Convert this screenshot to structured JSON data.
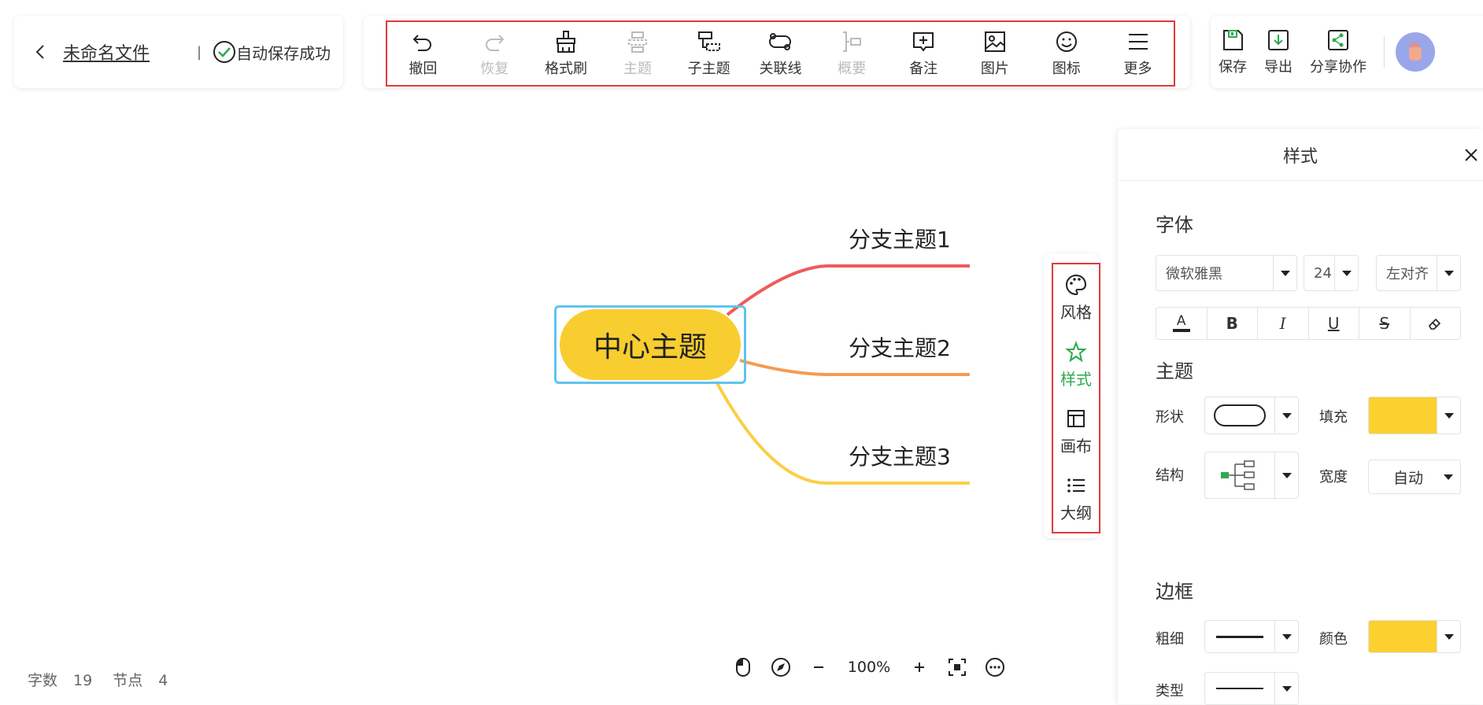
{
  "header": {
    "file_name": "未命名文件",
    "separator": "|",
    "save_status": "自动保存成功"
  },
  "toolbar": {
    "items": [
      {
        "label": "撤回",
        "icon": "undo-icon",
        "disabled": false
      },
      {
        "label": "恢复",
        "icon": "redo-icon",
        "disabled": true
      },
      {
        "label": "格式刷",
        "icon": "format-brush-icon",
        "disabled": false
      },
      {
        "label": "主题",
        "icon": "topic-icon",
        "disabled": true
      },
      {
        "label": "子主题",
        "icon": "subtopic-icon",
        "disabled": false
      },
      {
        "label": "关联线",
        "icon": "relation-line-icon",
        "disabled": false
      },
      {
        "label": "概要",
        "icon": "summary-icon",
        "disabled": true
      },
      {
        "label": "备注",
        "icon": "note-icon",
        "disabled": false
      },
      {
        "label": "图片",
        "icon": "image-icon",
        "disabled": false
      },
      {
        "label": "图标",
        "icon": "emoji-icon",
        "disabled": false
      },
      {
        "label": "更多",
        "icon": "menu-icon",
        "disabled": false
      }
    ]
  },
  "right_actions": {
    "save": "保存",
    "export": "导出",
    "share": "分享协作",
    "accent": "#2cab4f"
  },
  "mindmap": {
    "center": "中心主题",
    "center_color": "#f8cd2f",
    "branches": [
      {
        "label": "分支主题1",
        "color": "#ef5a5a"
      },
      {
        "label": "分支主题2",
        "color": "#f79a4f"
      },
      {
        "label": "分支主题3",
        "color": "#f9cf45"
      }
    ]
  },
  "side_tabs": [
    {
      "label": "风格",
      "icon": "palette-icon",
      "active": false
    },
    {
      "label": "样式",
      "icon": "style-star-icon",
      "active": true
    },
    {
      "label": "画布",
      "icon": "canvas-layout-icon",
      "active": false
    },
    {
      "label": "大纲",
      "icon": "outline-list-icon",
      "active": false
    }
  ],
  "style_panel": {
    "title": "样式",
    "font_section": "字体",
    "font_family": "微软雅黑",
    "font_size": "24",
    "align": "左对齐",
    "format_buttons": [
      "A",
      "B",
      "I",
      "U",
      "S",
      "eraser"
    ],
    "topic_section": "主题",
    "shape_label": "形状",
    "fill_label": "填充",
    "fill_color": "#fbd02f",
    "structure_label": "结构",
    "width_label": "宽度",
    "width_value": "自动",
    "border_section": "边框",
    "thickness_label": "粗细",
    "color_label": "颜色",
    "border_color": "#fbd02f",
    "type_label": "类型"
  },
  "status_bar": {
    "word_count_label": "字数",
    "word_count": "19",
    "node_count_label": "节点",
    "node_count": "4"
  },
  "zoom": {
    "level": "100%"
  }
}
